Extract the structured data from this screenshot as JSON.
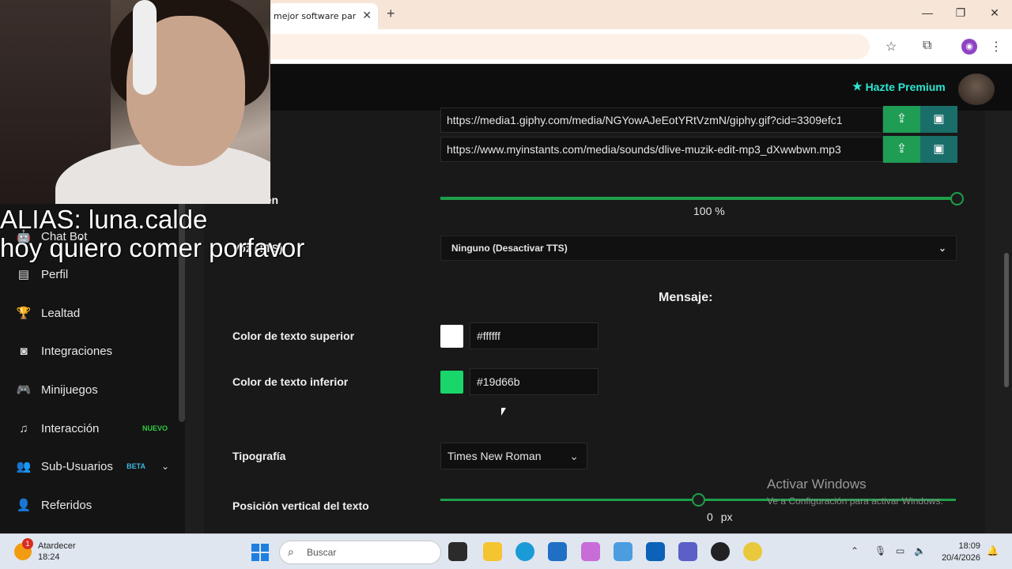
{
  "browser": {
    "tab_title": "mejor software para",
    "tab_close": "✕",
    "new_tab": "+",
    "window_controls": {
      "minimize": "—",
      "maximize": "❐",
      "close": "✕"
    },
    "toolbar_icons": [
      "star-icon",
      "extensions-icon",
      "profile-icon",
      "menu-icon"
    ]
  },
  "header": {
    "premium_label": "Hazte Premium"
  },
  "sidebar": {
    "items": [
      {
        "label": "Chat Bot",
        "icon": "robot-icon"
      },
      {
        "label": "Perfil",
        "icon": "id-card-icon"
      },
      {
        "label": "Lealtad",
        "icon": "trophy-icon"
      },
      {
        "label": "Integraciones",
        "icon": "discord-icon"
      },
      {
        "label": "Minijuegos",
        "icon": "gamepad-icon"
      },
      {
        "label": "Interacción",
        "icon": "music-icon",
        "badge": "NUEVO"
      },
      {
        "label": "Sub-Usuarios",
        "icon": "users-icon",
        "badge": "BETA"
      },
      {
        "label": "Referidos",
        "icon": "user-group-icon"
      }
    ]
  },
  "main": {
    "gif_url": "https://media1.giphy.com/media/NGYowAJeEotYRtVzmN/giphy.gif?cid=3309efc1",
    "sound_url": "https://www.myinstants.com/media/sounds/dlive-muzik-edit-mp3_dXwwbwn.mp3",
    "volume_label": "Volumen",
    "volume_value": "100",
    "volume_unit": "%",
    "volume_level": 1.0,
    "tts_label": "Voz (TTS)",
    "tts_selected": "Ninguno (Desactivar TTS)",
    "message_title": "Mensaje:",
    "top_color_label": "Color de texto superior",
    "top_color_value": "#ffffff",
    "bottom_color_label": "Color de texto inferior",
    "bottom_color_value": "#19d66b",
    "font_label": "Tipografía",
    "font_selected": "Times New Roman",
    "vertical_label": "Posición vertical del texto",
    "vertical_value": "0",
    "vertical_unit": "px",
    "vertical_level": 0.5
  },
  "overlay": {
    "line1": "ALIAS: luna.calde",
    "line2": "hoy quiero comer porfavor"
  },
  "watermark": {
    "title": "Activar Windows",
    "subtitle": "Ve a Configuración para activar Windows."
  },
  "taskbar": {
    "weather_title": "Atardecer",
    "weather_time": "18:24",
    "weather_badge": "1",
    "search_placeholder": "Buscar",
    "time": "18:09",
    "date": "20/4/2026"
  },
  "colors": {
    "accent_green": "#1e9e4a",
    "premium": "#2ee6d2",
    "swatch_top": "#ffffff",
    "swatch_bottom": "#19d66b"
  }
}
